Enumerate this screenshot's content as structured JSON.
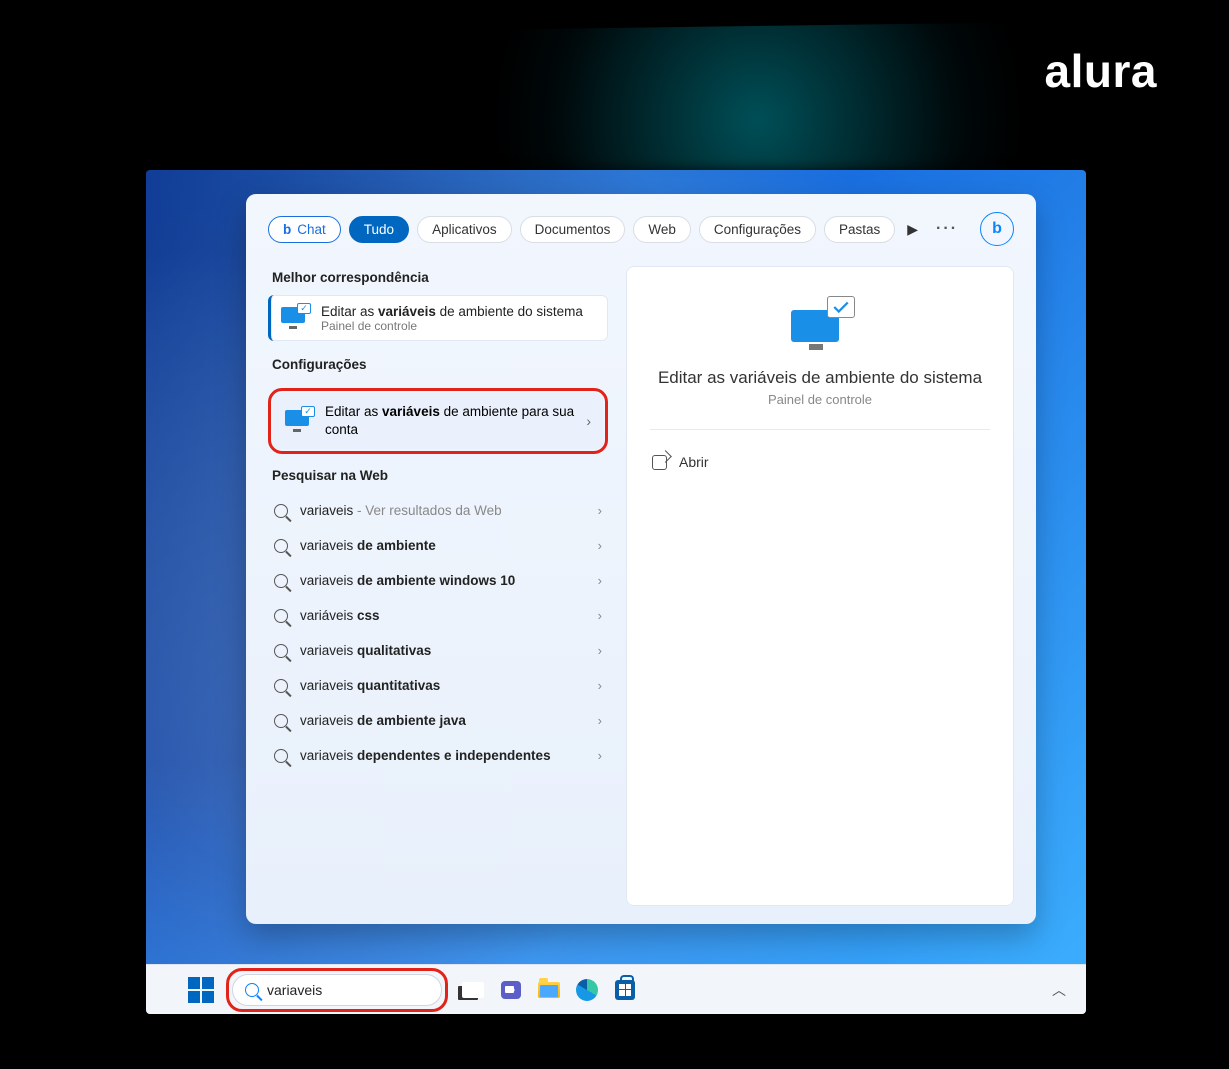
{
  "brand": "alura",
  "pills": {
    "chat": "Chat",
    "tudo": "Tudo",
    "aplicativos": "Aplicativos",
    "documentos": "Documentos",
    "web": "Web",
    "configuracoes": "Configurações",
    "pastas": "Pastas"
  },
  "sections": {
    "best": "Melhor correspondência",
    "settings": "Configurações",
    "web": "Pesquisar na Web"
  },
  "best_match": {
    "pre": "Editar as ",
    "bold": "variáveis",
    "post": " de ambiente do sistema",
    "sub": "Painel de controle"
  },
  "settings_item": {
    "pre": "Editar as ",
    "bold": "variáveis",
    "post": " de ambiente para sua conta"
  },
  "web_items": [
    {
      "pre": "variaveis",
      "bold": "",
      "post": "",
      "suffix": " - Ver resultados da Web"
    },
    {
      "pre": "variaveis ",
      "bold": "de ambiente",
      "post": "",
      "suffix": ""
    },
    {
      "pre": "variaveis ",
      "bold": "de ambiente windows 10",
      "post": "",
      "suffix": ""
    },
    {
      "pre": "variáveis ",
      "bold": "css",
      "post": "",
      "suffix": ""
    },
    {
      "pre": "variaveis ",
      "bold": "qualitativas",
      "post": "",
      "suffix": ""
    },
    {
      "pre": "variaveis ",
      "bold": "quantitativas",
      "post": "",
      "suffix": ""
    },
    {
      "pre": "variaveis ",
      "bold": "de ambiente java",
      "post": "",
      "suffix": ""
    },
    {
      "pre": "variaveis ",
      "bold": "dependentes e independentes",
      "post": "",
      "suffix": ""
    }
  ],
  "detail": {
    "title": "Editar as variáveis de ambiente do sistema",
    "sub": "Painel de controle",
    "open": "Abrir"
  },
  "taskbar": {
    "search_value": "variaveis"
  }
}
